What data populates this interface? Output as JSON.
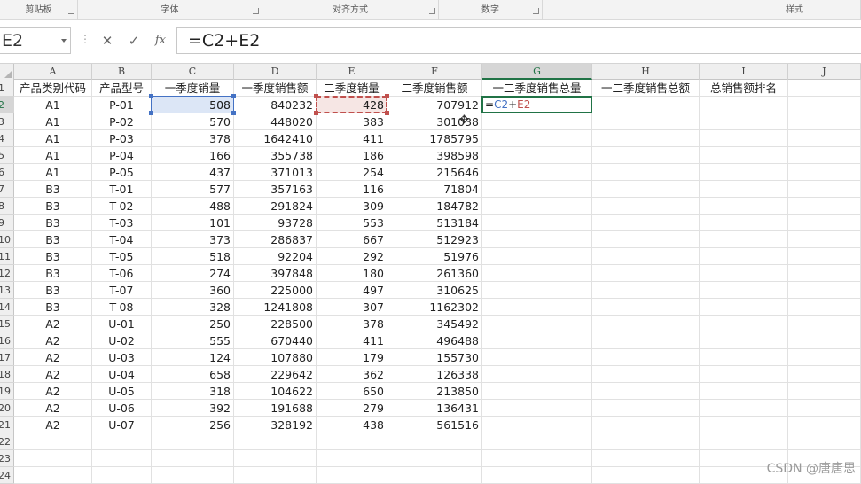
{
  "ribbon": {
    "groups": [
      "剪贴板",
      "字体",
      "对齐方式",
      "数字",
      "样式"
    ]
  },
  "formula_bar": {
    "name_box": "E2",
    "cancel_icon": "✕",
    "enter_icon": "✓",
    "function_icon": "fx",
    "formula": "=C2+E2"
  },
  "columns": [
    "A",
    "B",
    "C",
    "D",
    "E",
    "F",
    "G",
    "H",
    "I",
    "J"
  ],
  "rows": [
    "1",
    "2",
    "3",
    "4",
    "5",
    "6",
    "7",
    "8",
    "9",
    "10",
    "11",
    "12",
    "13",
    "14",
    "15",
    "16",
    "17",
    "18",
    "19",
    "20",
    "21",
    "22",
    "23",
    "24"
  ],
  "headers": [
    "产品类别代码",
    "产品型号",
    "一季度销量",
    "一季度销售额",
    "二季度销量",
    "二季度销售额",
    "一二季度销售总量",
    "一二季度销售总额",
    "总销售额排名"
  ],
  "data": [
    [
      "A1",
      "P-01",
      "508",
      "840232",
      "428",
      "707912"
    ],
    [
      "A1",
      "P-02",
      "570",
      "448020",
      "383",
      "301038"
    ],
    [
      "A1",
      "P-03",
      "378",
      "1642410",
      "411",
      "1785795"
    ],
    [
      "A1",
      "P-04",
      "166",
      "355738",
      "186",
      "398598"
    ],
    [
      "A1",
      "P-05",
      "437",
      "371013",
      "254",
      "215646"
    ],
    [
      "B3",
      "T-01",
      "577",
      "357163",
      "116",
      "71804"
    ],
    [
      "B3",
      "T-02",
      "488",
      "291824",
      "309",
      "184782"
    ],
    [
      "B3",
      "T-03",
      "101",
      "93728",
      "553",
      "513184"
    ],
    [
      "B3",
      "T-04",
      "373",
      "286837",
      "667",
      "512923"
    ],
    [
      "B3",
      "T-05",
      "518",
      "92204",
      "292",
      "51976"
    ],
    [
      "B3",
      "T-06",
      "274",
      "397848",
      "180",
      "261360"
    ],
    [
      "B3",
      "T-07",
      "360",
      "225000",
      "497",
      "310625"
    ],
    [
      "B3",
      "T-08",
      "328",
      "1241808",
      "307",
      "1162302"
    ],
    [
      "A2",
      "U-01",
      "250",
      "228500",
      "378",
      "345492"
    ],
    [
      "A2",
      "U-02",
      "555",
      "670440",
      "411",
      "496488"
    ],
    [
      "A2",
      "U-03",
      "124",
      "107880",
      "179",
      "155730"
    ],
    [
      "A2",
      "U-04",
      "658",
      "229642",
      "362",
      "126338"
    ],
    [
      "A2",
      "U-05",
      "318",
      "104622",
      "650",
      "213850"
    ],
    [
      "A2",
      "U-06",
      "392",
      "191688",
      "279",
      "136431"
    ],
    [
      "A2",
      "U-07",
      "256",
      "328192",
      "438",
      "561516"
    ]
  ],
  "editing_cell": {
    "prefix": "=",
    "ref1": "C2",
    "op": "+",
    "ref2": "E2"
  },
  "colors": {
    "accent_green": "#217346",
    "ref_blue": "#4472c4",
    "ref_red": "#c0504d"
  },
  "watermark": "CSDN @唐唐思"
}
